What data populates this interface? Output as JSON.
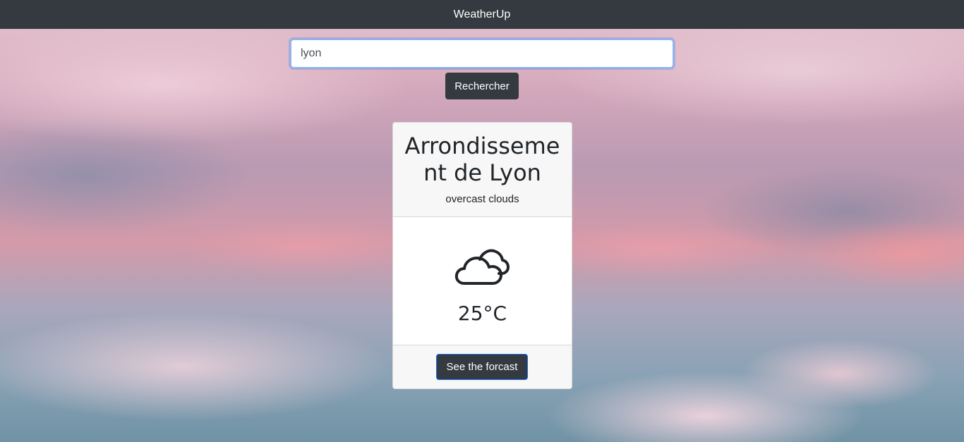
{
  "navbar": {
    "brand": "WeatherUp"
  },
  "search": {
    "value": "lyon",
    "button_label": "Rechercher"
  },
  "weather_card": {
    "city": "Arrondissement de Lyon",
    "description": "overcast clouds",
    "icon": "clouds-icon",
    "temperature": "25°C",
    "forecast_button_label": "See the forcast"
  },
  "colors": {
    "navbar_bg": "#343a40",
    "button_bg": "#343a40",
    "card_header_bg": "#f7f7f7"
  }
}
